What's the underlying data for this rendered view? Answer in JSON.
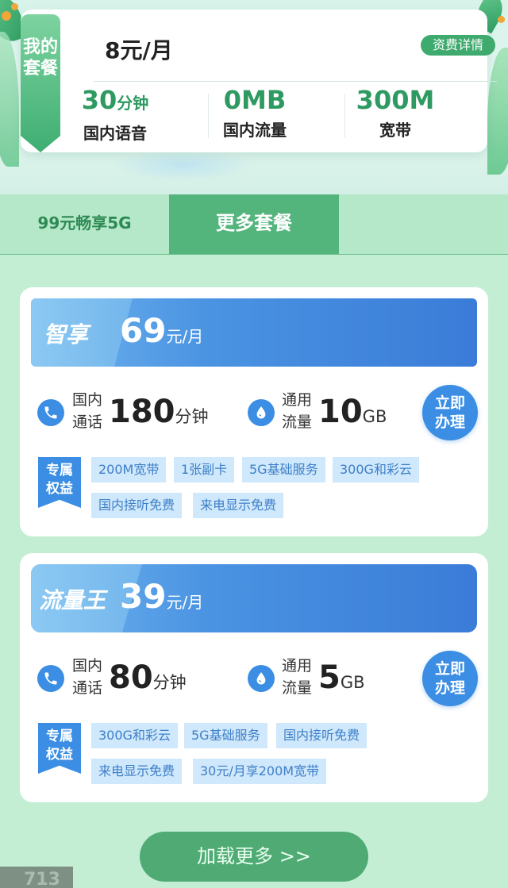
{
  "current_plan": {
    "ribbon": "我的套餐",
    "price": "8元/月",
    "detail_button": "资费详情",
    "stats": [
      {
        "value": "30",
        "unit": "分钟",
        "label": "国内语音"
      },
      {
        "value": "0MB",
        "unit": "",
        "label": "国内流量"
      },
      {
        "value": "300M",
        "unit": "",
        "label": "宽带"
      }
    ]
  },
  "tabs": [
    {
      "label": "99元畅享5G",
      "active": false
    },
    {
      "label": "更多套餐",
      "active": true
    }
  ],
  "packages": [
    {
      "name": "智享",
      "price": "69",
      "price_unit": "元/月",
      "call_label_1": "国内",
      "call_label_2": "通话",
      "call_value": "180",
      "call_unit": "分钟",
      "data_label_1": "通用",
      "data_label_2": "流量",
      "data_value": "10",
      "data_unit": "GB",
      "apply_1": "立即",
      "apply_2": "办理",
      "perk_badge_1": "专属",
      "perk_badge_2": "权益",
      "perks": [
        "200M宽带",
        "1张副卡",
        "5G基础服务",
        "300G和彩云",
        "国内接听免费",
        "来电显示免费"
      ]
    },
    {
      "name": "流量王",
      "price": "39",
      "price_unit": "元/月",
      "call_label_1": "国内",
      "call_label_2": "通话",
      "call_value": "80",
      "call_unit": "分钟",
      "data_label_1": "通用",
      "data_label_2": "流量",
      "data_value": "5",
      "data_unit": "GB",
      "apply_1": "立即",
      "apply_2": "办理",
      "perk_badge_1": "专属",
      "perk_badge_2": "权益",
      "perks": [
        "300G和彩云",
        "5G基础服务",
        "国内接听免费",
        "来电显示免费",
        "30元/月享200M宽带"
      ]
    }
  ],
  "load_more": "加载更多 >>",
  "corner_number": "713",
  "colors": {
    "accent_green": "#3eaa6e",
    "accent_blue": "#3b8ee3",
    "background": "#c3eed4"
  },
  "icons": [
    "phone-icon",
    "water-drop-icon"
  ]
}
